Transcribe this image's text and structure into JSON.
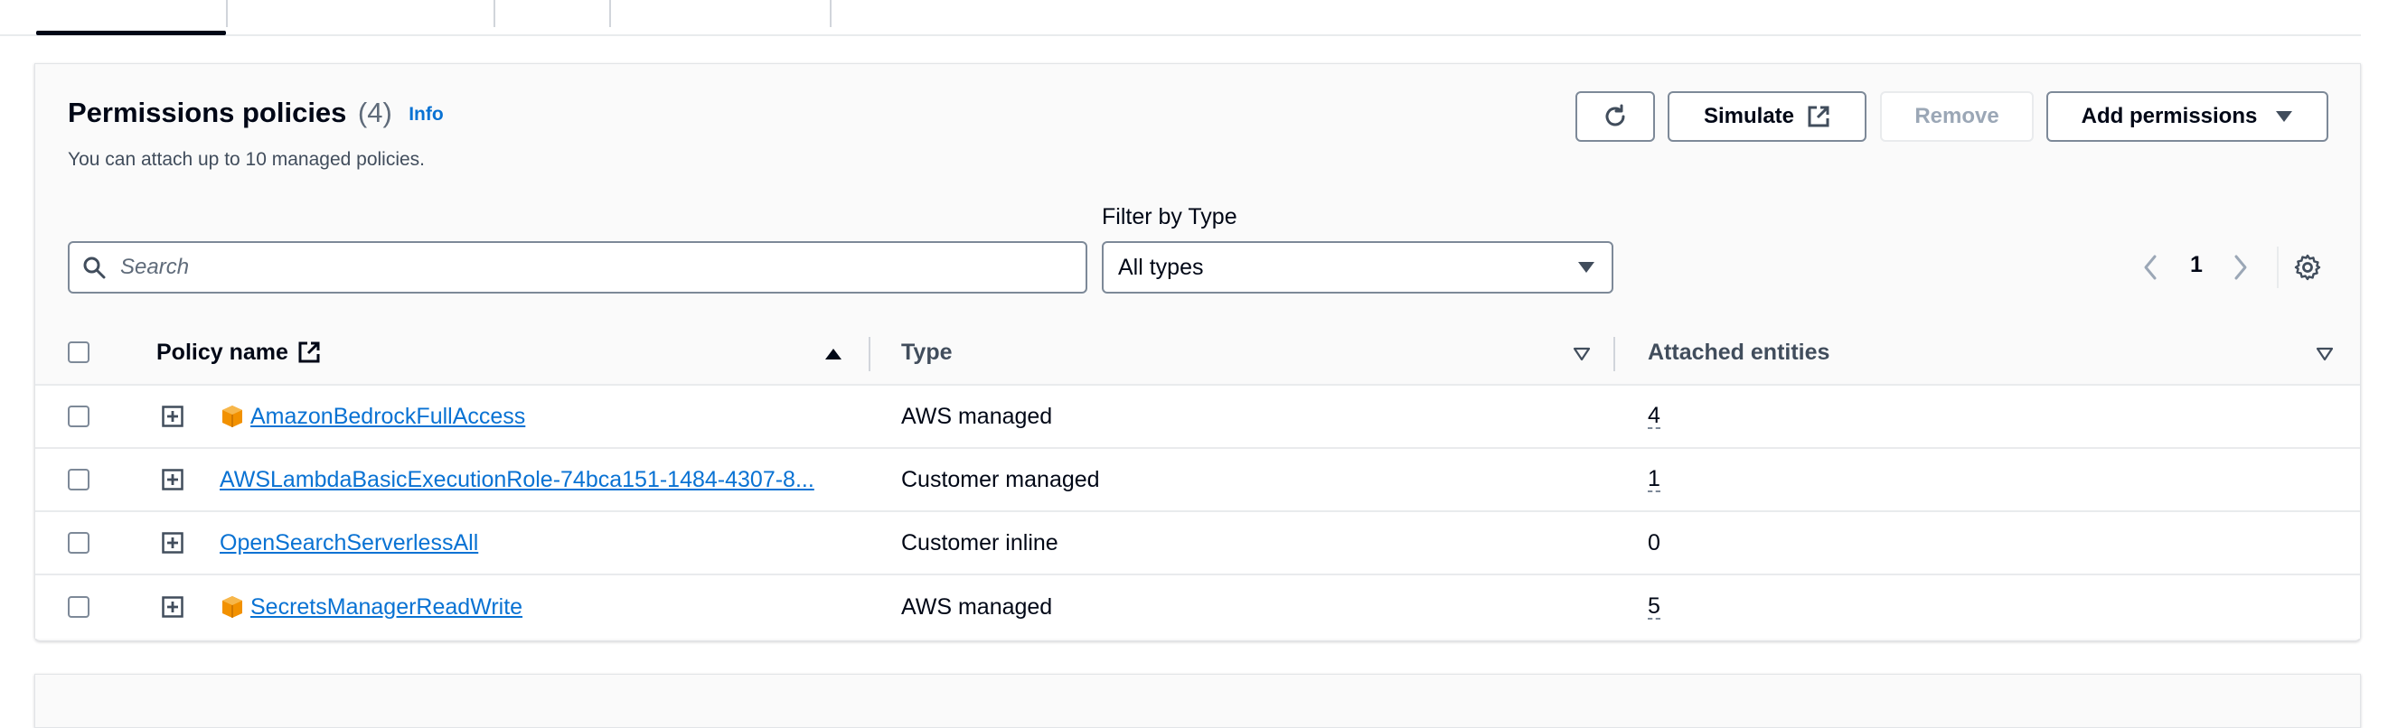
{
  "panel": {
    "title": "Permissions policies",
    "count": "(4)",
    "info_label": "Info",
    "description": "You can attach up to 10 managed policies."
  },
  "toolbar": {
    "simulate_label": "Simulate",
    "remove_label": "Remove",
    "add_permissions_label": "Add permissions"
  },
  "filter": {
    "search_placeholder": "Search",
    "type_label": "Filter by Type",
    "type_value": "All types"
  },
  "pagination": {
    "current_page": "1"
  },
  "table": {
    "columns": {
      "name": "Policy name",
      "type": "Type",
      "entities": "Attached entities"
    },
    "rows": [
      {
        "name": "AmazonBedrockFullAccess",
        "aws_icon": true,
        "type": "AWS managed",
        "entities": "4"
      },
      {
        "name": "AWSLambdaBasicExecutionRole-74bca151-1484-4307-8...",
        "aws_icon": false,
        "type": "Customer managed",
        "entities": "1"
      },
      {
        "name": "OpenSearchServerlessAll",
        "aws_icon": false,
        "type": "Customer inline",
        "entities": "0"
      },
      {
        "name": "SecretsManagerReadWrite",
        "aws_icon": true,
        "type": "AWS managed",
        "entities": "5"
      }
    ]
  },
  "colors": {
    "link": "#0972d3",
    "text": "#000716",
    "border": "#7d8998",
    "aws_badge": "#f29100"
  }
}
